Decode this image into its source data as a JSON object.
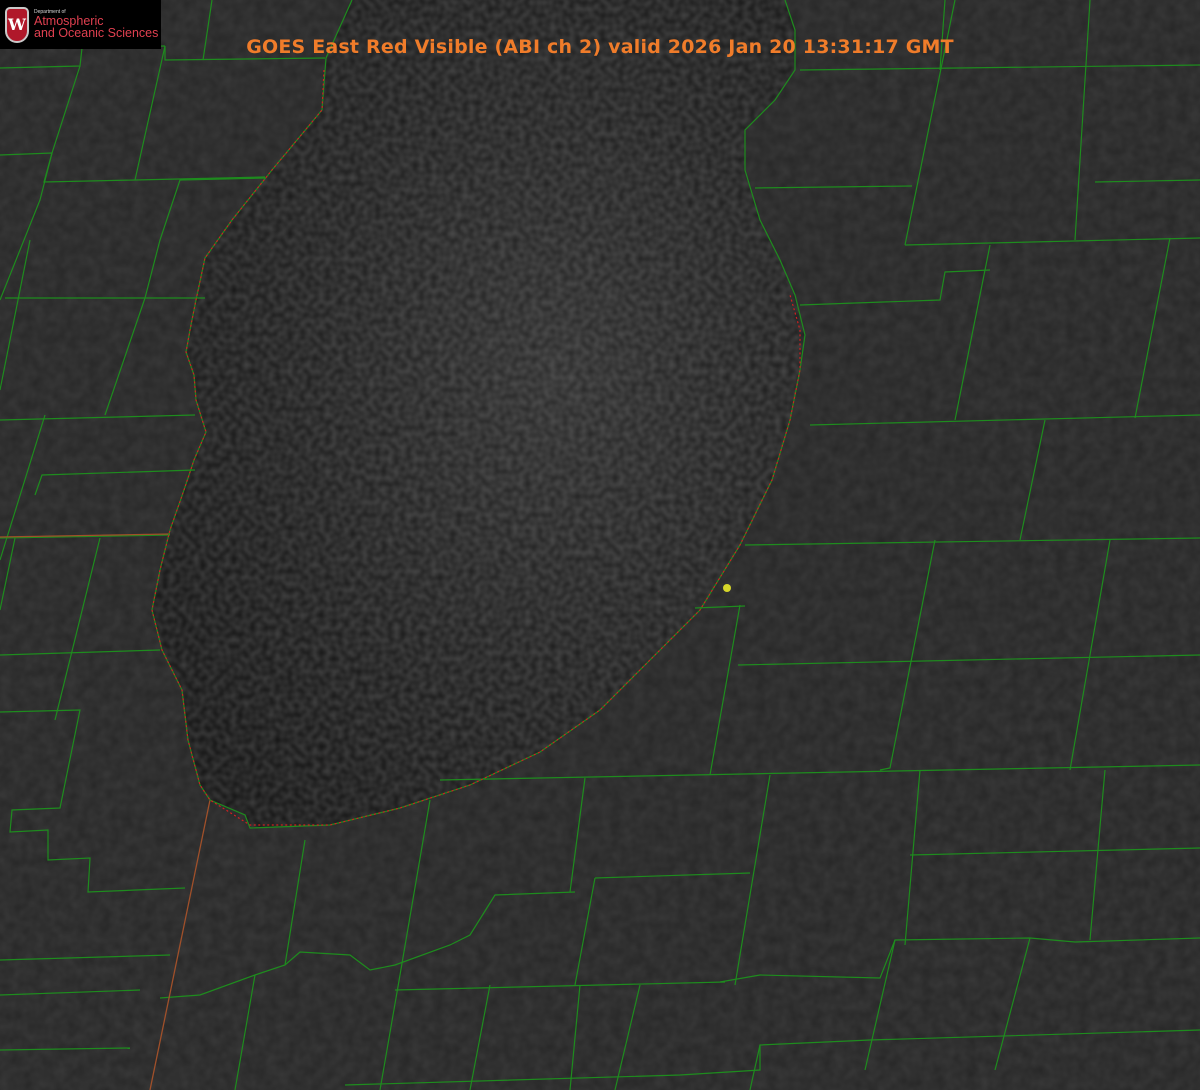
{
  "title": {
    "text": "GOES East Red Visible (ABI ch 2) valid 2026 Jan 20 13:31:17 GMT",
    "color": "#f07c2a"
  },
  "logo": {
    "crest_letter": "W",
    "department": "Department of",
    "name_line1": "Atmospheric",
    "name_line2": "and Oceanic Sciences",
    "color": "#c41e3a"
  },
  "colors": {
    "land": "#262626",
    "lake": "#151515",
    "county_lines": "#1e8c1e",
    "state_line": "#a0502a",
    "coastline_dotted": "#d02020",
    "marker": "#d6d62a"
  },
  "layers": [
    "visible-imagery",
    "county-boundaries",
    "state-boundaries",
    "lake-shoreline",
    "station-marker"
  ]
}
